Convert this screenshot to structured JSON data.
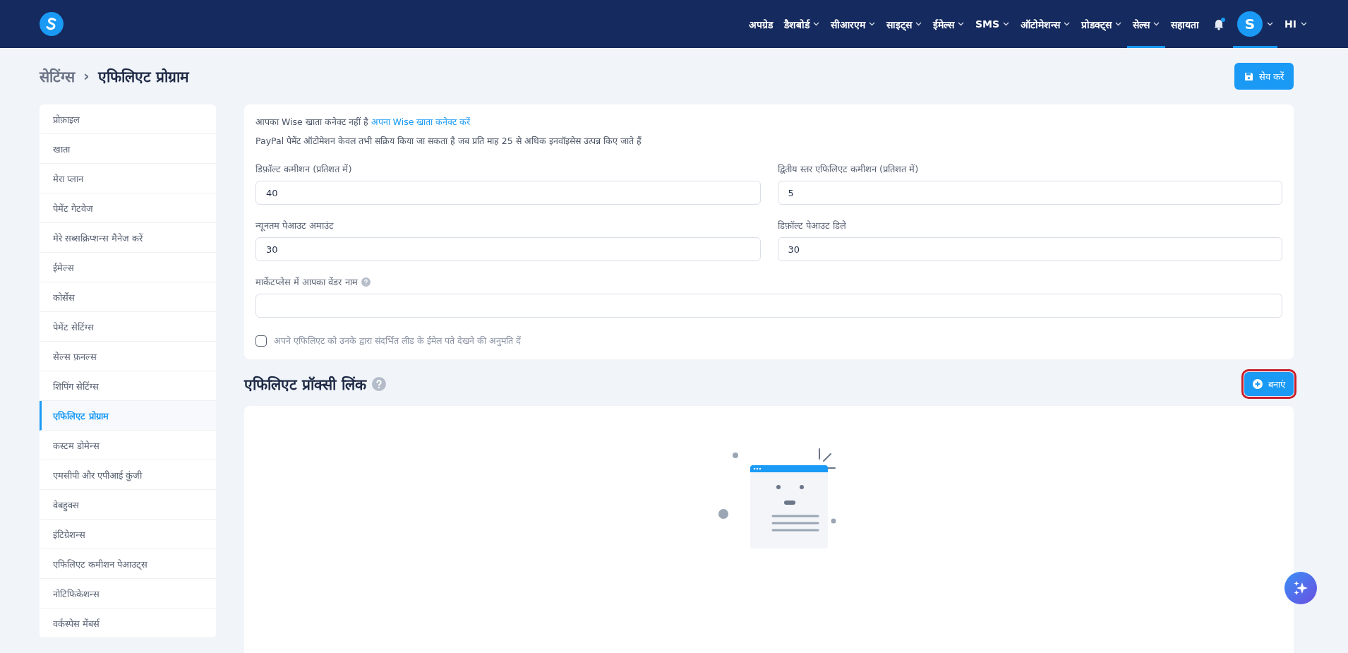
{
  "nav": {
    "items": [
      {
        "label": "अपग्रेड",
        "caret": false,
        "selected": false
      },
      {
        "label": "डैशबोर्ड",
        "caret": true,
        "selected": false
      },
      {
        "label": "सीआरएम",
        "caret": true,
        "selected": false
      },
      {
        "label": "साइट्स",
        "caret": true,
        "selected": false
      },
      {
        "label": "ईमेल्स",
        "caret": true,
        "selected": false
      },
      {
        "label": "SMS",
        "caret": true,
        "selected": false
      },
      {
        "label": "ऑटोमेशन्स",
        "caret": true,
        "selected": false
      },
      {
        "label": "प्रोडक्ट्स",
        "caret": true,
        "selected": false
      },
      {
        "label": "सेल्स",
        "caret": true,
        "selected": true
      },
      {
        "label": "सहायता",
        "caret": false,
        "selected": false
      }
    ],
    "avatar_letter": "S",
    "user": "HI"
  },
  "breadcrumb": {
    "parent": "सेटिंग्स",
    "separator": "›",
    "current": "एफिलिएट प्रोग्राम"
  },
  "save_button": "सेव करें",
  "sidebar": {
    "items": [
      {
        "label": "प्रोफ़ाइल",
        "selected": false
      },
      {
        "label": "खाता",
        "selected": false
      },
      {
        "label": "मेरा प्लान",
        "selected": false
      },
      {
        "label": "पेमेंट गेटवेज",
        "selected": false
      },
      {
        "label": "मेरे सब्सक्रिप्शन्स मैनेज करें",
        "selected": false
      },
      {
        "label": "ईमेल्स",
        "selected": false
      },
      {
        "label": "कोर्सेस",
        "selected": false
      },
      {
        "label": "पेमेंट सेटिंग्स",
        "selected": false
      },
      {
        "label": "सेल्स फ़नल्स",
        "selected": false
      },
      {
        "label": "शिपिंग सेटिंग्स",
        "selected": false
      },
      {
        "label": "एफिलिएट प्रोग्राम",
        "selected": true
      },
      {
        "label": "कस्टम डोमेन्स",
        "selected": false
      },
      {
        "label": "एमसीपी और एपीआई कुंजी",
        "selected": false
      },
      {
        "label": "वेबहुक्स",
        "selected": false
      },
      {
        "label": "इंटिग्रेशन्स",
        "selected": false
      },
      {
        "label": "एफिलिएट कमीशन पेआउट्स",
        "selected": false
      },
      {
        "label": "नोटिफिकेशन्स",
        "selected": false
      },
      {
        "label": "वर्कस्पेस मेंबर्स",
        "selected": false
      }
    ]
  },
  "settings": {
    "wise_notice": "आपका Wise खाता कनेक्ट नहीं है",
    "wise_link": "अपना Wise खाता कनेक्ट करें",
    "paypal_notice": "PayPal पेमेंट ऑटोमेशन केवल तभी सक्रिय किया जा सकता है जब प्रति माह 25 से अधिक इनवॉइसेस उत्पन्न किए जाते हैं",
    "fields": [
      {
        "label": "डिफ़ॉल्ट कमीशन (प्रतिशत में)",
        "value": "40",
        "help": false,
        "wide": false
      },
      {
        "label": "द्वितीय स्तर एफिलिएट कमीशन (प्रतिशत में)",
        "value": "5",
        "help": false,
        "wide": false
      },
      {
        "label": "न्यूनतम पेआउट अमाउंट",
        "value": "30",
        "help": false,
        "wide": false
      },
      {
        "label": "डिफ़ॉल्ट पेआउट डिले",
        "value": "30",
        "help": false,
        "wide": false
      },
      {
        "label": "मार्केटप्लेस में आपका वेंडर नाम",
        "help": true,
        "wide": true
      }
    ],
    "checkbox": {
      "label": "अपने एफिलिएट को उनके द्वारा संदर्भित लीड के ईमेल पते देखने की अनुमति दें",
      "checked": false
    }
  },
  "proxy_links": {
    "title": "एफिलिएट प्रॉक्सी लिंक",
    "create_button": "बनाएं"
  }
}
